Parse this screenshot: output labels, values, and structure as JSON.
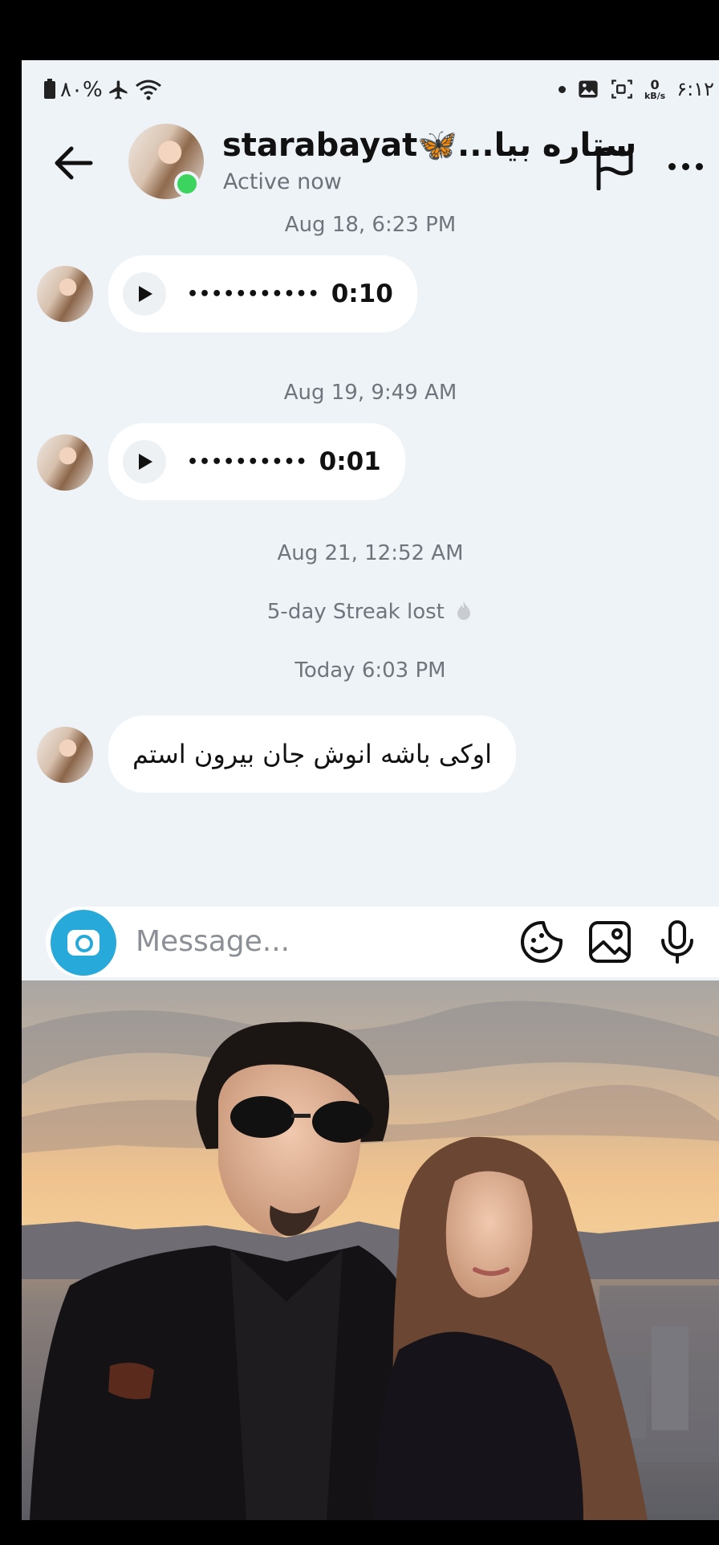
{
  "status_bar": {
    "battery": "٨٠%",
    "network_speed_value": "0",
    "network_speed_unit": "kB/s",
    "time": "۶:۱۲"
  },
  "header": {
    "name": "starabayat🦋...ستاره بیا",
    "status": "Active now"
  },
  "messages": [
    {
      "type": "timestamp",
      "text": "Aug 18, 6:23 PM"
    },
    {
      "type": "voice",
      "waveform": "•••••••••••",
      "duration": "0:10"
    },
    {
      "type": "timestamp",
      "text": "Aug 19, 9:49 AM"
    },
    {
      "type": "voice",
      "waveform": "••••••••••",
      "duration": "0:01"
    },
    {
      "type": "timestamp",
      "text": "Aug 21, 12:52 AM"
    },
    {
      "type": "system",
      "text": "5-day Streak lost"
    },
    {
      "type": "timestamp",
      "text": "Today 6:03 PM"
    },
    {
      "type": "text",
      "text": "اوکی باشه انوش جان بیرون استم"
    }
  ],
  "composer": {
    "placeholder": "Message..."
  },
  "colors": {
    "accent": "#27a9d9",
    "online": "#3cd35f",
    "background": "#eef3f8"
  }
}
